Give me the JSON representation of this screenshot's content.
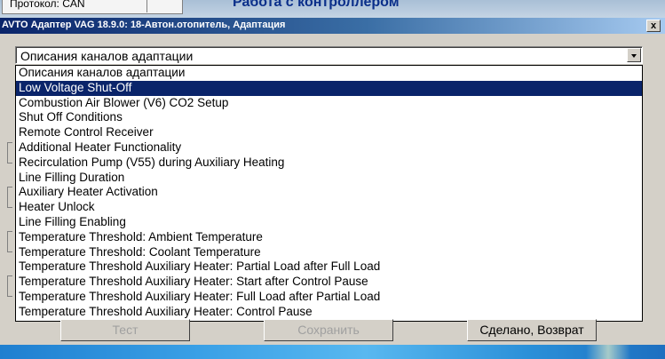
{
  "background": {
    "protocol_label": "Протокол: CAN",
    "heading": "Работа с контроллером"
  },
  "dialog": {
    "title": "AVTO Адаптер VAG 18.9.0: 18-Автон.отопитель, Адаптация",
    "close_glyph": "x",
    "select_value": "Описания каналов адаптации",
    "options": [
      "Описания каналов адаптации",
      "Low Voltage Shut-Off",
      "Combustion Air Blower (V6) CO2 Setup",
      "Shut Off Conditions",
      "Remote Control Receiver",
      "Additional Heater Functionality",
      "Recirculation Pump (V55) during Auxiliary Heating",
      "Line Filling Duration",
      "Auxiliary Heater Activation",
      "Heater Unlock",
      "Line Filling Enabling",
      "Temperature Threshold: Ambient Temperature",
      "Temperature Threshold: Coolant Temperature",
      "Temperature Threshold Auxiliary Heater: Partial Load after Full Load",
      "Temperature Threshold Auxiliary Heater: Start after Control Pause",
      "Temperature Threshold Auxiliary Heater: Full Load after Partial Load",
      "Temperature Threshold Auxiliary Heater: Control Pause"
    ],
    "selected_index": 1,
    "buttons": {
      "test": "Тест",
      "save": "Сохранить",
      "done": "Сделано, Возврат"
    }
  },
  "colors": {
    "selection": "#0a246a",
    "title_start": "#0a246a",
    "title_end": "#a6caf0"
  }
}
